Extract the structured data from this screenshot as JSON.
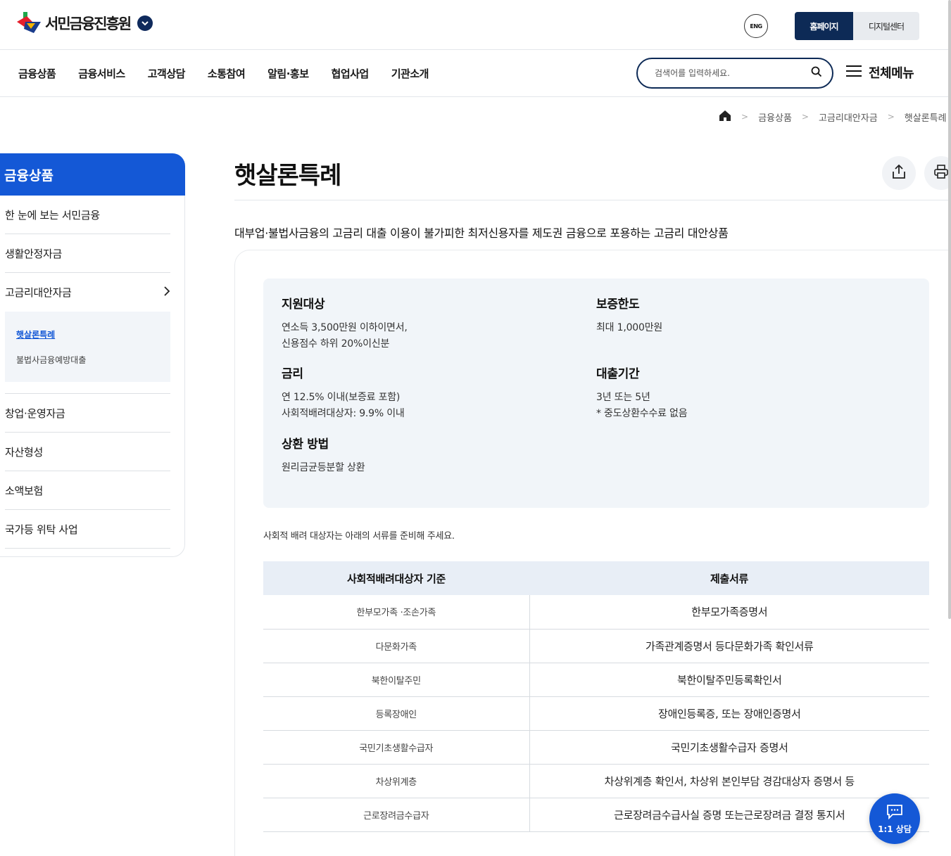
{
  "header": {
    "logo_text": "서민금융진흥원",
    "eng_label": "ENG",
    "site_tabs": [
      "홈페이지",
      "디지털센터"
    ]
  },
  "gnb": {
    "items": [
      "금융상품",
      "금융서비스",
      "고객상담",
      "소통참여",
      "알림·홍보",
      "협업사업",
      "기관소개"
    ],
    "search_placeholder": "검색어를 입력하세요.",
    "all_menu": "전체메뉴"
  },
  "breadcrumb": [
    "금융상품",
    "고금리대안자금",
    "햇살론특례"
  ],
  "sidebar": {
    "title": "금융상품",
    "items": [
      "한 눈에 보는 서민금융",
      "생활안정자금",
      "고금리대안자금"
    ],
    "sub_items": [
      "햇살론특례",
      "불법사금융예방대출"
    ],
    "items_after": [
      "창업·운영자금",
      "자산형성",
      "소액보험",
      "국가등 위탁 사업"
    ]
  },
  "main": {
    "title": "햇살론특례",
    "description": "대부업·불법사금융의 고금리 대출 이용이 불가피한 최저신용자를 제도권 금융으로 포용하는 고금리 대안상품",
    "info": {
      "target_label": "지원대상",
      "target_line1": "연소득 3,500만원 이하이면서,",
      "target_line2": "신용점수 하위 20%이신분",
      "limit_label": "보증한도",
      "limit_value": "최대 1,000만원",
      "rate_label": "금리",
      "rate_line1": "연 12.5% 이내(보증료 포함)",
      "rate_line2": "사회적배려대상자: 9.9% 이내",
      "period_label": "대출기간",
      "period_line1": "3년 또는 5년",
      "period_line2": "* 중도상환수수료 없음",
      "repay_label": "상환 방법",
      "repay_value": "원리금균등분할 상환"
    },
    "note": "사회적 배려 대상자는 아래의 서류를 준비해 주세요.",
    "table": {
      "headers": [
        "사회적배려대상자 기준",
        "제출서류"
      ],
      "rows": [
        [
          "한부모가족 ·조손가족",
          "한부모가족증명서"
        ],
        [
          "다문화가족",
          "가족관계증명서 등다문화가족 확인서류"
        ],
        [
          "북한이탈주민",
          "북한이탈주민등록확인서"
        ],
        [
          "등록장애인",
          "장애인등록증, 또는 장애인증명서"
        ],
        [
          "국민기초생활수급자",
          "국민기초생활수급자 증명서"
        ],
        [
          "차상위계층",
          "차상위계층 확인서, 차상위 본인부담 경감대상자 증명서 등"
        ],
        [
          "근로장려금수급자",
          "근로장려금수급사실 증명 또는근로장려금 결정 통지서"
        ]
      ]
    }
  },
  "chat": {
    "label": "1:1 상담"
  },
  "colors": {
    "brand_navy": "#0d2a56",
    "brand_blue": "#1458d6"
  }
}
